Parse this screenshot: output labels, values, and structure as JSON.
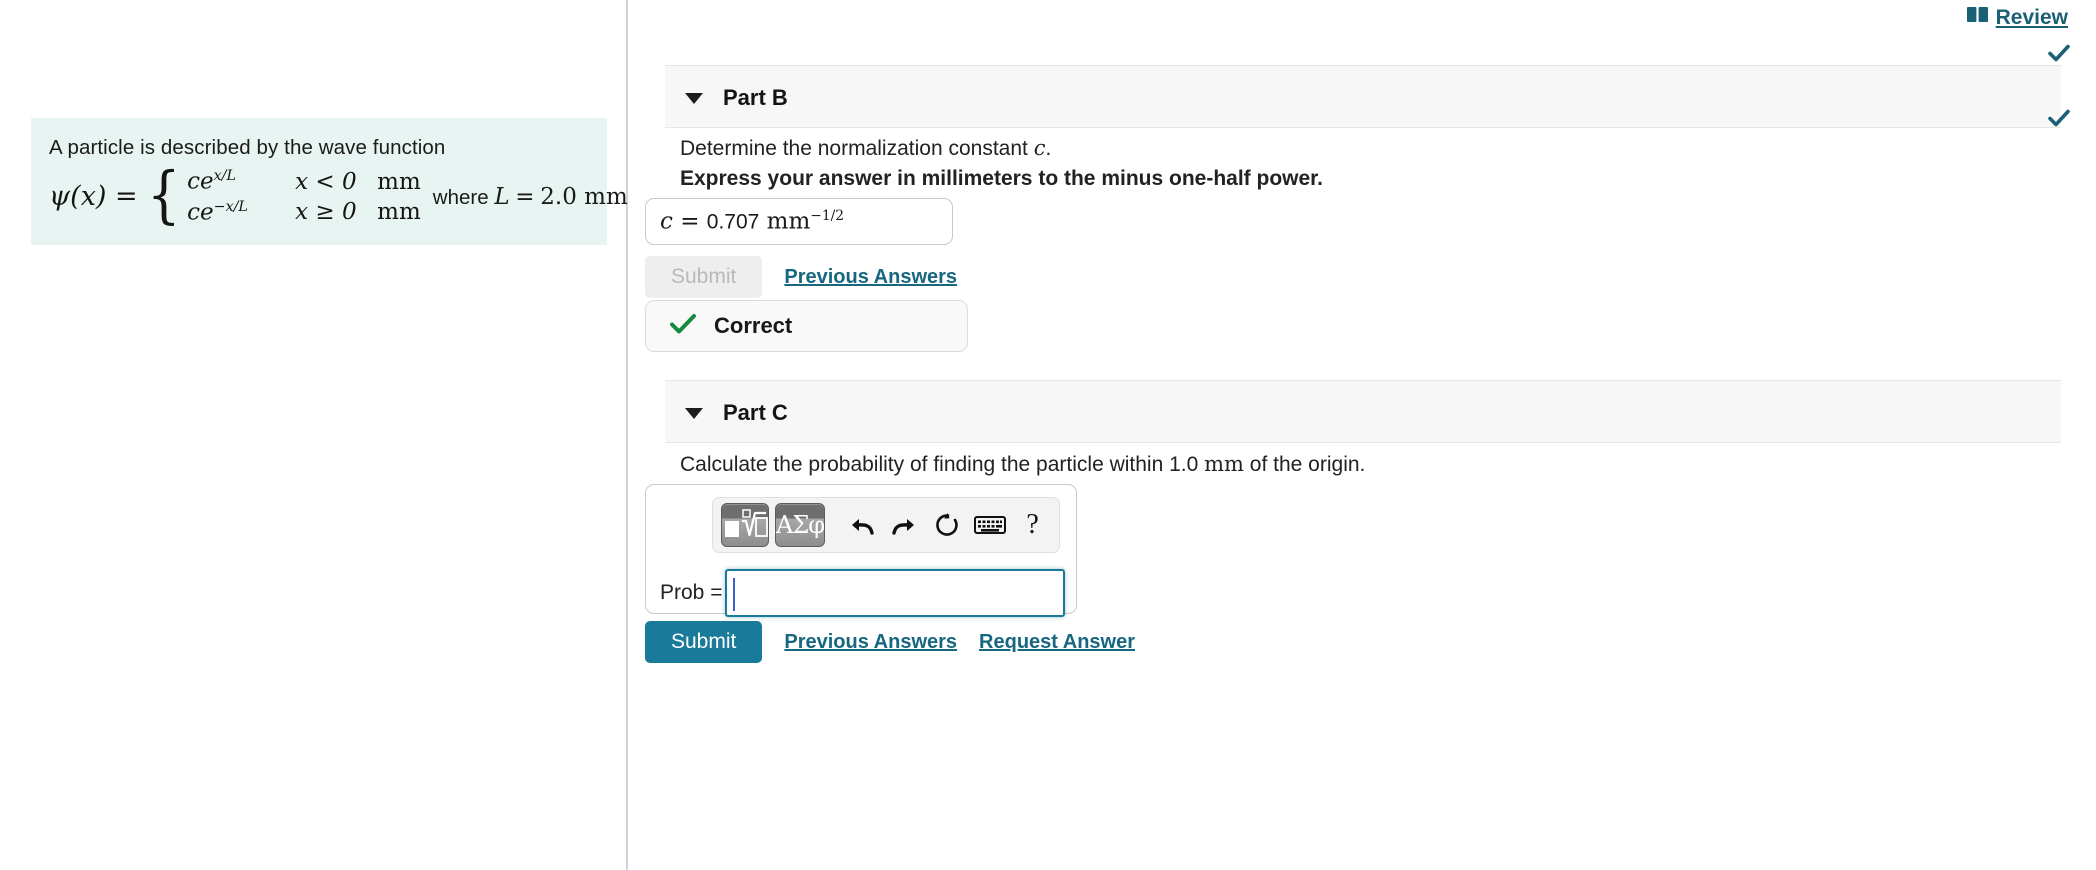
{
  "left_panel": {
    "intro": "A particle is described by the wave function",
    "formula": {
      "lhs": "ψ(x) =",
      "cases": [
        {
          "expr_base": "ce",
          "expr_sup": "x/L",
          "condition": "x < 0",
          "unit": "mm"
        },
        {
          "expr_base": "ce",
          "expr_sup": "−x/L",
          "condition": "x ≥ 0",
          "unit": "mm"
        }
      ],
      "where_prefix": "where",
      "where_symbol": "L",
      "where_equals": "=",
      "where_value": "2.0 mm."
    }
  },
  "header": {
    "review_label": " Review",
    "review_icon": "book-icon",
    "accent_color": "#1a6176"
  },
  "parts": [
    {
      "id": "part-b",
      "title": "Part B",
      "status_icon": "check-icon",
      "question": "Determine the normalization constant ",
      "question_symbol": "c",
      "question_suffix": ".",
      "instruction": "Express your answer in millimeters to the minus one-half power.",
      "answer": {
        "label": "c",
        "equals": "=",
        "value": "0.707",
        "unit": "mm",
        "unit_exponent": "−1/2"
      },
      "submit_label": "Submit",
      "submit_enabled": false,
      "previous_answers_label": "Previous Answers",
      "feedback": {
        "icon": "check-icon",
        "text": "Correct",
        "color": "#158a3e"
      }
    },
    {
      "id": "part-c",
      "title": "Part C",
      "question_prefix": "Calculate the probability of finding the particle within 1.0 ",
      "question_unit": "mm",
      "question_suffix": " of the origin.",
      "math_toolbar": {
        "template_button": "math-template-icon",
        "symbols_button": "ΑΣφ",
        "undo": "undo-icon",
        "redo": "redo-icon",
        "reset": "reset-icon",
        "keyboard": "keyboard-icon",
        "help": "?"
      },
      "input": {
        "label": "Prob =",
        "value": "",
        "placeholder": "",
        "focused": true
      },
      "submit_label": "Submit",
      "submit_enabled": true,
      "previous_answers_label": "Previous Answers",
      "request_answer_label": "Request Answer"
    }
  ]
}
